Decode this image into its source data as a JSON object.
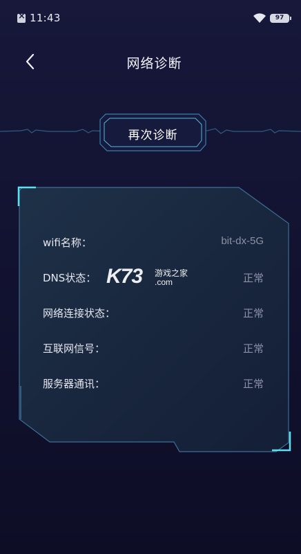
{
  "status_bar": {
    "time": "11:43",
    "battery": "97",
    "icons": [
      "notification-icon",
      "wifi-icon",
      "battery-icon"
    ]
  },
  "header": {
    "title": "网络诊断",
    "back_icon": "chevron-left-icon"
  },
  "actions": {
    "rediagnose_label": "再次诊断"
  },
  "diagnostics": {
    "rows": [
      {
        "label": "wifi名称：",
        "value": "bit-dx-5G"
      },
      {
        "label": "DNS状态：",
        "value": "正常"
      },
      {
        "label": "网络连接状态：",
        "value": "正常"
      },
      {
        "label": "互联网信号：",
        "value": "正常"
      },
      {
        "label": "服务器通讯：",
        "value": "正常"
      }
    ]
  },
  "watermark": {
    "logo": "K73",
    "site_name": "游戏之家",
    "domain": ".com"
  },
  "colors": {
    "background": "#141534",
    "accent_cyan": "#3fd0e6",
    "panel_fill": "#1b2b44",
    "value_gray": "#8c91a6"
  }
}
